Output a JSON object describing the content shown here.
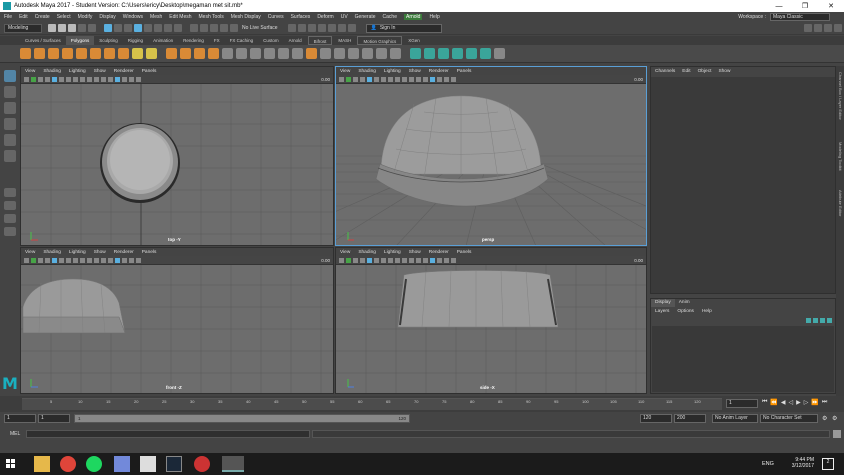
{
  "window": {
    "title": "Autodesk Maya 2017 - Student Version: C:\\Users\\ericy\\Desktop\\megaman met sit.mb*",
    "controls": [
      "—",
      "❐",
      "✕"
    ]
  },
  "menubar": {
    "items": [
      "File",
      "Edit",
      "Create",
      "Select",
      "Modify",
      "Display",
      "Windows",
      "Mesh",
      "Edit Mesh",
      "Mesh Tools",
      "Mesh Display",
      "Curves",
      "Surfaces",
      "Deform",
      "UV",
      "Generate",
      "Cache",
      "Arnold",
      "Help"
    ],
    "highlighted": "Arnold",
    "workspace_label": "Workspace :",
    "workspace_value": "Maya Classic"
  },
  "statusline": {
    "mode": "Modeling",
    "live_surface": "No Live Surface",
    "signin": "Sign In"
  },
  "shelf": {
    "tabs": [
      "Curves / Surfaces",
      "Polygons",
      "Sculpting",
      "Rigging",
      "Animation",
      "Rendering",
      "FX",
      "FX Caching",
      "Custom",
      "Arnold",
      "Bifrost",
      "MASH",
      "Motion Graphics",
      "XGen"
    ],
    "active_tab": "Polygons"
  },
  "viewport_menu": [
    "View",
    "Shading",
    "Lighting",
    "Show",
    "Renderer",
    "Panels"
  ],
  "viewports": [
    {
      "id": "top",
      "camera": "top -Y",
      "value": "0.00"
    },
    {
      "id": "persp",
      "camera": "persp",
      "value": "0.00"
    },
    {
      "id": "front",
      "camera": "front -Z",
      "value": "0.00"
    },
    {
      "id": "side",
      "camera": "side -X",
      "value": "0.00"
    }
  ],
  "channel_box": {
    "menu": [
      "Channels",
      "Edit",
      "Object",
      "Show"
    ]
  },
  "side_tabs": [
    "Channel Box / Layer Editor",
    "Modeling Toolkit",
    "Attribute Editor"
  ],
  "layer_editor": {
    "tabs": [
      "Display",
      "Anim"
    ],
    "active_tab": "Display",
    "menu": [
      "Layers",
      "Options",
      "Help"
    ]
  },
  "time_slider": {
    "ticks": [
      "5",
      "10",
      "15",
      "20",
      "25",
      "30",
      "35",
      "40",
      "45",
      "50",
      "55",
      "60",
      "65",
      "70",
      "75",
      "80",
      "85",
      "90",
      "95",
      "100",
      "105",
      "110",
      "115",
      "120"
    ],
    "current_frame": "1"
  },
  "range_slider": {
    "start": "1",
    "start_inner": "1",
    "bar_start": "1",
    "bar_end": "120",
    "end_inner": "120",
    "end": "200",
    "anim_layer": "No Anim Layer",
    "char_set": "No Character Set"
  },
  "command_line": {
    "label": "MEL"
  },
  "taskbar": {
    "time": "9:44 PM",
    "date": "3/12/2017",
    "lang": "ENG",
    "notifications": "2"
  }
}
